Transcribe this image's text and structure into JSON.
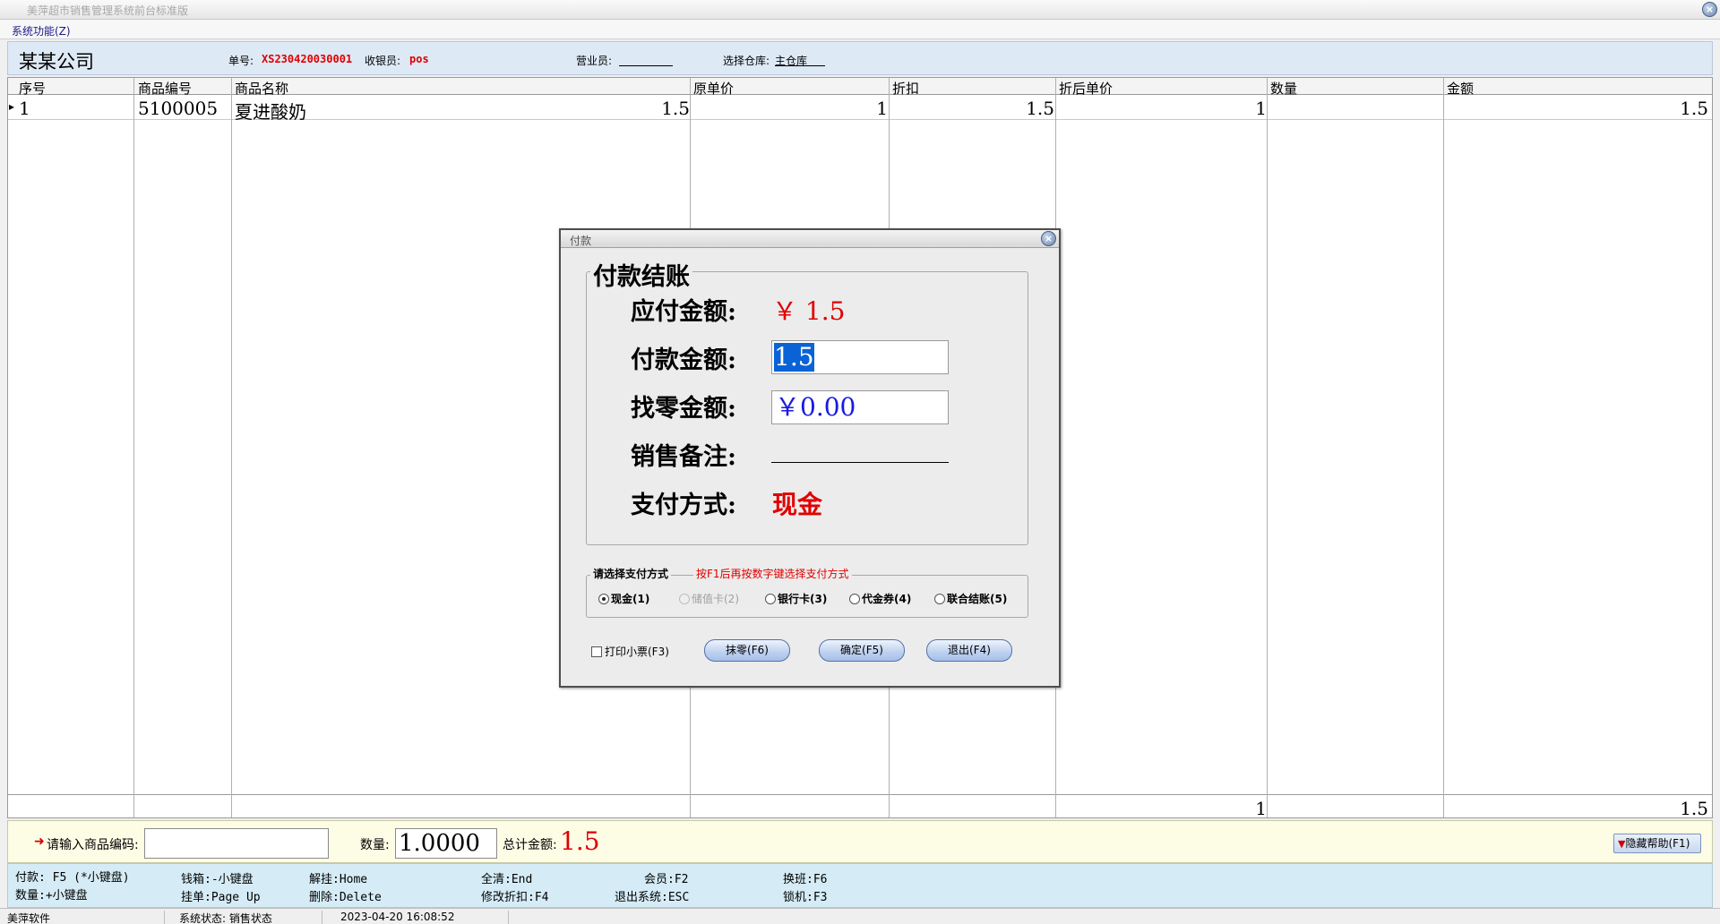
{
  "window": {
    "title": "美萍超市销售管理系统前台标准版"
  },
  "menu": {
    "system": "系统功能(Z)"
  },
  "info": {
    "company": "某某公司",
    "order_label": "单号:",
    "order_no": "XS230420030001",
    "cashier_label": "收银员:",
    "cashier": "pos",
    "clerk_label": "营业员:",
    "clerk": "",
    "warehouse_label": "选择仓库:",
    "warehouse": "主仓库"
  },
  "grid": {
    "columns": [
      "序号",
      "商品编号",
      "商品名称",
      "原单价",
      "折扣",
      "折后单价",
      "数量",
      "金额"
    ],
    "rows": [
      {
        "seq": "1",
        "code": "5100005",
        "name": "夏进酸奶",
        "price": "1.5",
        "discount": "1",
        "disc_price": "1.5",
        "qty": "1",
        "amount": "1.5"
      }
    ],
    "footer": {
      "qty": "1",
      "amount": "1.5"
    }
  },
  "input": {
    "code_label": "请输入商品编码:",
    "code_value": "",
    "qty_label": "数量:",
    "qty_value": "1.0000",
    "total_label": "总计金额:",
    "total_value": "1.5",
    "help_button": "隐藏帮助(F1)"
  },
  "hints": [
    "付款: F5 (*小键盘)",
    "数量:+小键盘",
    "钱箱:-小键盘",
    "挂单:Page Up",
    "解挂:Home",
    "删除:Delete",
    "全清:End",
    "修改折扣:F4",
    "会员:F2",
    "退出系统:ESC",
    "换班:F6",
    "锁机:F3"
  ],
  "status": {
    "vendor": "美萍软件",
    "state": "系统状态: 销售状态",
    "datetime": "2023-04-20 16:08:52"
  },
  "dialog": {
    "title": "付款",
    "group_title": "付款结账",
    "due_label": "应付金额:",
    "due_value": "￥ 1.5",
    "pay_label": "付款金额:",
    "pay_value": "1.5",
    "change_label": "找零金额:",
    "change_value": "￥0.00",
    "note_label": "销售备注:",
    "note_value": "",
    "method_label": "支付方式:",
    "method_value": "现金",
    "choose_title": "请选择支付方式",
    "choose_tip": "按F1后再按数字键选择支付方式",
    "options": [
      "现金(1)",
      "储值卡(2)",
      "银行卡(3)",
      "代金券(4)",
      "联合结账(5)"
    ],
    "print_receipt": "打印小票(F3)",
    "btn_round": "抹零(F6)",
    "btn_ok": "确定(F5)",
    "btn_exit": "退出(F4)"
  },
  "colors": {
    "accent_red": "#e00000",
    "selection_blue": "#0a63d6",
    "change_blue": "#1a1ae0"
  }
}
